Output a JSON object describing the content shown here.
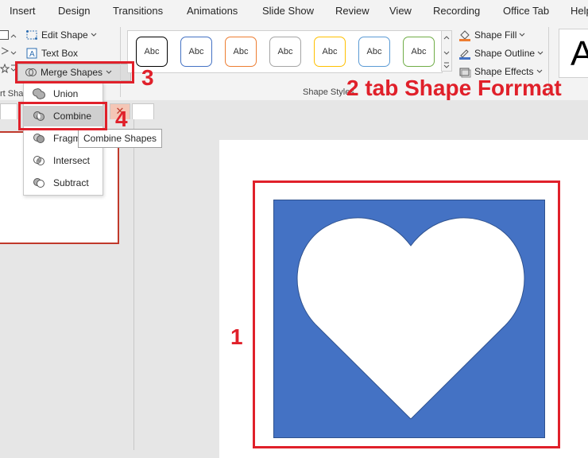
{
  "menu": {
    "tabs": [
      "Insert",
      "Design",
      "Transitions",
      "Animations",
      "Slide Show",
      "Review",
      "View",
      "Recording",
      "Office Tab",
      "Help"
    ]
  },
  "ribbon": {
    "edit_shape": "Edit Shape",
    "text_box": "Text Box",
    "merge_shapes": "Merge Shapes",
    "insert_shapes_partial": "rt Sha",
    "style_sample": "Abc",
    "shape_styles_label": "Shape Styles",
    "shape_fill": "Shape Fill",
    "shape_outline": "Shape Outline",
    "shape_effects": "Shape Effects",
    "wordart_partial": "A"
  },
  "merge_menu": {
    "items": [
      "Union",
      "Combine",
      "Fragment",
      "Intersect",
      "Subtract"
    ],
    "fragment_visible": "Fragm",
    "tooltip": "Combine Shapes"
  },
  "doc_tabs": {
    "close_glyph": "✕"
  },
  "annotations": {
    "step1": "1",
    "step2": "2 tab Shape Forrmat",
    "step3": "3",
    "step4": "4"
  },
  "colors": {
    "accent_red": "#e0202a",
    "shape_blue": "#4472c4",
    "style_outlines": [
      "#000000",
      "#4472c4",
      "#ed7d31",
      "#a5a5a5",
      "#ffc000",
      "#5b9bd5",
      "#70ad47"
    ]
  }
}
